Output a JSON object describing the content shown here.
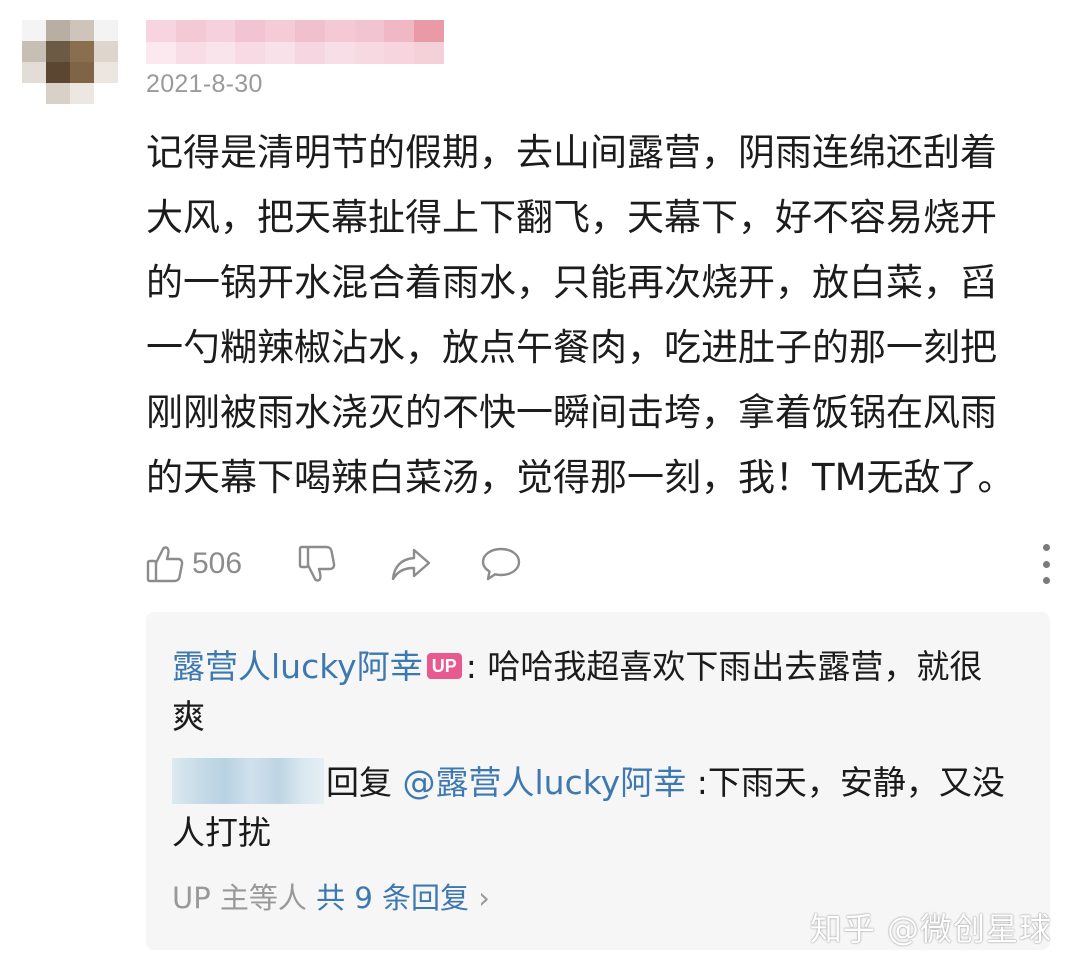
{
  "comment": {
    "date": "2021-8-30",
    "text": "记得是清明节的假期，去山间露营，阴雨连绵还刮着大风，把天幕扯得上下翻飞，天幕下，好不容易烧开的一锅开水混合着雨水，只能再次烧开，放白菜，舀一勺糊辣椒沾水，放点午餐肉，吃进肚子的那一刻把刚刚被雨水浇灭的不快一瞬间击垮，拿着饭锅在风雨的天幕下喝辣白菜汤，觉得那一刻，我！TM无敌了。",
    "like_count": "506",
    "icons": [
      "thumb-up-icon",
      "thumb-down-icon",
      "share-icon",
      "comment-icon",
      "more-vertical-icon"
    ]
  },
  "replies": {
    "reply_1": {
      "author": "露营人lucky阿幸",
      "badge": "UP",
      "separator": ":",
      "text": "哈哈我超喜欢下雨出去露营，就很爽"
    },
    "reply_2": {
      "reply_word": "回复",
      "mention": "@露营人lucky阿幸",
      "separator": ":",
      "text": "下雨天，安静，又没人打扰"
    },
    "more": {
      "prefix": "UP 主等人",
      "count": "共 9 条回复",
      "chevron": "›"
    }
  },
  "watermark": "知乎 @微创星球",
  "colors": {
    "link_blue": "#3e78b0",
    "up_badge": "#e85a8f",
    "reply_bg": "#f6f6f6",
    "meta_gray": "#9a9a9a"
  }
}
